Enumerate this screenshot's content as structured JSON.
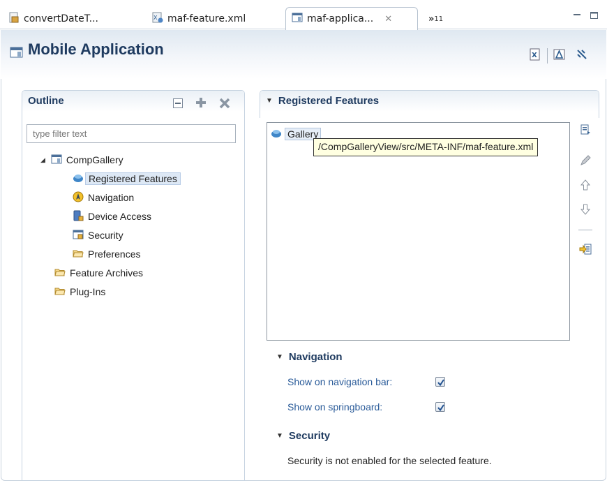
{
  "tabs": [
    {
      "label": "convertDateT...",
      "icon": "java-file-icon"
    },
    {
      "label": "maf-feature.xml",
      "icon": "maf-feature-icon"
    },
    {
      "label": "maf-applica...",
      "icon": "maf-application-icon",
      "active": true
    }
  ],
  "tab_overflow": {
    "symbol": "»",
    "count": "11"
  },
  "editor": {
    "title": "Mobile Application"
  },
  "outline": {
    "title": "Outline",
    "filter_placeholder": "type filter text",
    "tree": {
      "root": "CompGallery",
      "children": [
        "Registered Features",
        "Navigation",
        "Device Access",
        "Security",
        "Preferences"
      ],
      "siblings": [
        "Feature Archives",
        "Plug-Ins"
      ]
    }
  },
  "registered_features": {
    "title": "Registered Features",
    "items": [
      "Gallery"
    ],
    "tooltip": "/CompGalleryView/src/META-INF/maf-feature.xml"
  },
  "navigation": {
    "title": "Navigation",
    "show_on_nav_bar_label": "Show on navigation bar:",
    "show_on_nav_bar_checked": true,
    "show_on_springboard_label": "Show on springboard:",
    "show_on_springboard_checked": true
  },
  "security": {
    "title": "Security",
    "message": "Security is not enabled for the selected feature."
  },
  "colors": {
    "accent": "#1e3a5f",
    "label_blue": "#2a5b99",
    "selection": "#dde8f5"
  }
}
